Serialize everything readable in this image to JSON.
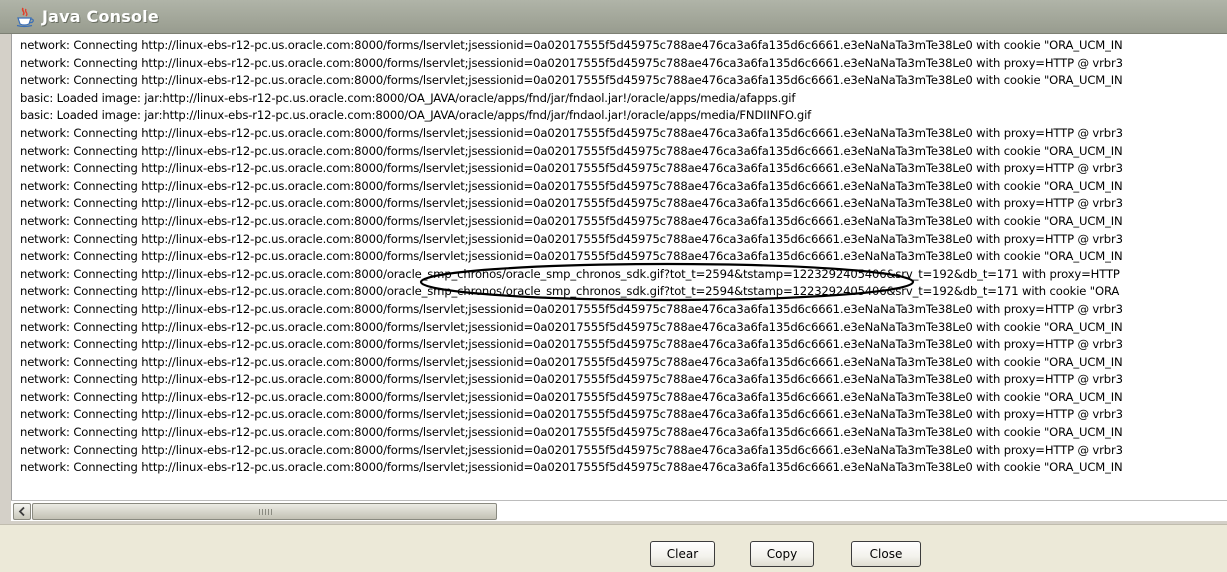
{
  "window": {
    "title": "Java Console",
    "icon": "java-coffee-cup-icon"
  },
  "console": {
    "lines": [
      "network: Connecting http://linux-ebs-r12-pc.us.oracle.com:8000/forms/lservlet;jsessionid=0a02017555f5d45975c788ae476ca3a6fa135d6c6661.e3eNaNaTa3mTe38Le0 with cookie \"ORA_UCM_IN",
      "network: Connecting http://linux-ebs-r12-pc.us.oracle.com:8000/forms/lservlet;jsessionid=0a02017555f5d45975c788ae476ca3a6fa135d6c6661.e3eNaNaTa3mTe38Le0 with proxy=HTTP @ vrbr3",
      "network: Connecting http://linux-ebs-r12-pc.us.oracle.com:8000/forms/lservlet;jsessionid=0a02017555f5d45975c788ae476ca3a6fa135d6c6661.e3eNaNaTa3mTe38Le0 with cookie \"ORA_UCM_IN",
      "basic: Loaded image: jar:http://linux-ebs-r12-pc.us.oracle.com:8000/OA_JAVA/oracle/apps/fnd/jar/fndaol.jar!/oracle/apps/media/afapps.gif",
      "basic: Loaded image: jar:http://linux-ebs-r12-pc.us.oracle.com:8000/OA_JAVA/oracle/apps/fnd/jar/fndaol.jar!/oracle/apps/media/FNDIINFO.gif",
      "network: Connecting http://linux-ebs-r12-pc.us.oracle.com:8000/forms/lservlet;jsessionid=0a02017555f5d45975c788ae476ca3a6fa135d6c6661.e3eNaNaTa3mTe38Le0 with proxy=HTTP @ vrbr3",
      "network: Connecting http://linux-ebs-r12-pc.us.oracle.com:8000/forms/lservlet;jsessionid=0a02017555f5d45975c788ae476ca3a6fa135d6c6661.e3eNaNaTa3mTe38Le0 with cookie \"ORA_UCM_IN",
      "network: Connecting http://linux-ebs-r12-pc.us.oracle.com:8000/forms/lservlet;jsessionid=0a02017555f5d45975c788ae476ca3a6fa135d6c6661.e3eNaNaTa3mTe38Le0 with proxy=HTTP @ vrbr3",
      "network: Connecting http://linux-ebs-r12-pc.us.oracle.com:8000/forms/lservlet;jsessionid=0a02017555f5d45975c788ae476ca3a6fa135d6c6661.e3eNaNaTa3mTe38Le0 with cookie \"ORA_UCM_IN",
      "network: Connecting http://linux-ebs-r12-pc.us.oracle.com:8000/forms/lservlet;jsessionid=0a02017555f5d45975c788ae476ca3a6fa135d6c6661.e3eNaNaTa3mTe38Le0 with proxy=HTTP @ vrbr3",
      "network: Connecting http://linux-ebs-r12-pc.us.oracle.com:8000/forms/lservlet;jsessionid=0a02017555f5d45975c788ae476ca3a6fa135d6c6661.e3eNaNaTa3mTe38Le0 with cookie \"ORA_UCM_IN",
      "network: Connecting http://linux-ebs-r12-pc.us.oracle.com:8000/forms/lservlet;jsessionid=0a02017555f5d45975c788ae476ca3a6fa135d6c6661.e3eNaNaTa3mTe38Le0 with proxy=HTTP @ vrbr3",
      "network: Connecting http://linux-ebs-r12-pc.us.oracle.com:8000/forms/lservlet;jsessionid=0a02017555f5d45975c788ae476ca3a6fa135d6c6661.e3eNaNaTa3mTe38Le0 with cookie \"ORA_UCM_IN",
      "network: Connecting http://linux-ebs-r12-pc.us.oracle.com:8000/oracle_smp_chronos/oracle_smp_chronos_sdk.gif?tot_t=2594&tstamp=1223292405406&srv_t=192&db_t=171 with proxy=HTTP",
      "network: Connecting http://linux-ebs-r12-pc.us.oracle.com:8000/oracle_smp_chronos/oracle_smp_chronos_sdk.gif?tot_t=2594&tstamp=1223292405406&srv_t=192&db_t=171 with cookie \"ORA",
      "network: Connecting http://linux-ebs-r12-pc.us.oracle.com:8000/forms/lservlet;jsessionid=0a02017555f5d45975c788ae476ca3a6fa135d6c6661.e3eNaNaTa3mTe38Le0 with proxy=HTTP @ vrbr3",
      "network: Connecting http://linux-ebs-r12-pc.us.oracle.com:8000/forms/lservlet;jsessionid=0a02017555f5d45975c788ae476ca3a6fa135d6c6661.e3eNaNaTa3mTe38Le0 with cookie \"ORA_UCM_IN",
      "network: Connecting http://linux-ebs-r12-pc.us.oracle.com:8000/forms/lservlet;jsessionid=0a02017555f5d45975c788ae476ca3a6fa135d6c6661.e3eNaNaTa3mTe38Le0 with proxy=HTTP @ vrbr3",
      "network: Connecting http://linux-ebs-r12-pc.us.oracle.com:8000/forms/lservlet;jsessionid=0a02017555f5d45975c788ae476ca3a6fa135d6c6661.e3eNaNaTa3mTe38Le0 with cookie \"ORA_UCM_IN",
      "network: Connecting http://linux-ebs-r12-pc.us.oracle.com:8000/forms/lservlet;jsessionid=0a02017555f5d45975c788ae476ca3a6fa135d6c6661.e3eNaNaTa3mTe38Le0 with proxy=HTTP @ vrbr3",
      "network: Connecting http://linux-ebs-r12-pc.us.oracle.com:8000/forms/lservlet;jsessionid=0a02017555f5d45975c788ae476ca3a6fa135d6c6661.e3eNaNaTa3mTe38Le0 with cookie \"ORA_UCM_IN",
      "network: Connecting http://linux-ebs-r12-pc.us.oracle.com:8000/forms/lservlet;jsessionid=0a02017555f5d45975c788ae476ca3a6fa135d6c6661.e3eNaNaTa3mTe38Le0 with proxy=HTTP @ vrbr3",
      "network: Connecting http://linux-ebs-r12-pc.us.oracle.com:8000/forms/lservlet;jsessionid=0a02017555f5d45975c788ae476ca3a6fa135d6c6661.e3eNaNaTa3mTe38Le0 with cookie \"ORA_UCM_IN",
      "network: Connecting http://linux-ebs-r12-pc.us.oracle.com:8000/forms/lservlet;jsessionid=0a02017555f5d45975c788ae476ca3a6fa135d6c6661.e3eNaNaTa3mTe38Le0 with proxy=HTTP @ vrbr3",
      "network: Connecting http://linux-ebs-r12-pc.us.oracle.com:8000/forms/lservlet;jsessionid=0a02017555f5d45975c788ae476ca3a6fa135d6c6661.e3eNaNaTa3mTe38Le0 with cookie \"ORA_UCM_IN"
    ]
  },
  "buttons": {
    "clear": "Clear",
    "copy": "Copy",
    "close": "Close"
  }
}
